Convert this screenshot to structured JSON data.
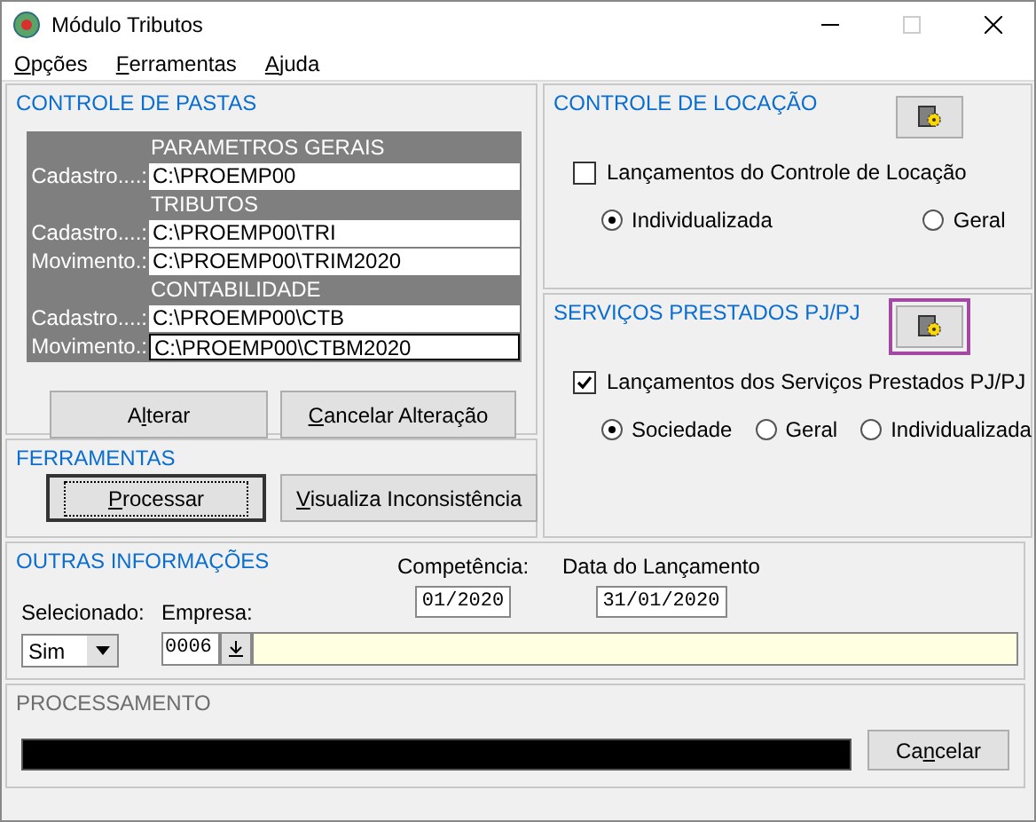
{
  "window": {
    "title": "Módulo Tributos",
    "maximize_disabled": true
  },
  "menu": [
    {
      "label": {
        "key": "O",
        "rest": "pções"
      }
    },
    {
      "label": {
        "key": "F",
        "rest": "erramentas"
      }
    },
    {
      "label": {
        "key": "A",
        "rest": "juda"
      }
    }
  ],
  "folders": {
    "title": "CONTROLE DE PASTAS",
    "groups": [
      {
        "heading": "PARAMETROS GERAIS",
        "rows": [
          {
            "label": "Cadastro....:",
            "value": "C:\\PROEMP00",
            "focused": false
          }
        ]
      },
      {
        "heading": "TRIBUTOS",
        "rows": [
          {
            "label": "Cadastro....:",
            "value": "C:\\PROEMP00\\TRI",
            "focused": false
          },
          {
            "label": "Movimento.:",
            "value": "C:\\PROEMP00\\TRIM2020",
            "focused": false
          }
        ]
      },
      {
        "heading": "CONTABILIDADE",
        "rows": [
          {
            "label": "Cadastro....:",
            "value": "C:\\PROEMP00\\CTB",
            "focused": false
          },
          {
            "label": "Movimento.:",
            "value": "C:\\PROEMP00\\CTBM2020",
            "focused": true
          }
        ]
      }
    ],
    "buttons": [
      {
        "label": {
          "lead": "A",
          "key": "l",
          "rest": "terar"
        }
      },
      {
        "label": {
          "key": "C",
          "rest": "ancelar Alteração"
        }
      }
    ]
  },
  "tools": {
    "title": "FERRAMENTAS",
    "buttons": [
      {
        "label": {
          "key": "P",
          "rest": "rocessar"
        },
        "default": true
      },
      {
        "label": {
          "key": "V",
          "rest": "isualiza Inconsistência"
        },
        "default": false
      }
    ]
  },
  "rental": {
    "title": "CONTROLE DE LOCAÇÃO",
    "highlighted": false,
    "checkbox": {
      "label": "Lançamentos do Controle de Locação",
      "checked": false
    },
    "radios": [
      {
        "label": "Individualizada",
        "selected": true
      },
      {
        "label": "Geral",
        "selected": false
      }
    ]
  },
  "services": {
    "title": "SERVIÇOS PRESTADOS PJ/PJ",
    "highlighted": true,
    "checkbox": {
      "label": "Lançamentos dos Serviços Prestados PJ/PJ",
      "checked": true
    },
    "radios": [
      {
        "label": "Sociedade",
        "selected": true
      },
      {
        "label": "Geral",
        "selected": false
      },
      {
        "label": "Individualizada",
        "selected": false
      }
    ]
  },
  "other": {
    "title": "OUTRAS INFORMAÇÕES",
    "competencia": {
      "label": "Competência:",
      "value": "01/2020"
    },
    "data": {
      "label": "Data do Lançamento",
      "value": "31/01/2020"
    },
    "selecionado": {
      "label": "Selecionado:",
      "value": "Sim"
    },
    "empresa": {
      "label": "Empresa:",
      "code": "0006"
    }
  },
  "processing": {
    "title": "PROCESSAMENTO",
    "button": {
      "label": {
        "lead": "Ca",
        "key": "n",
        "rest": "celar"
      }
    }
  }
}
